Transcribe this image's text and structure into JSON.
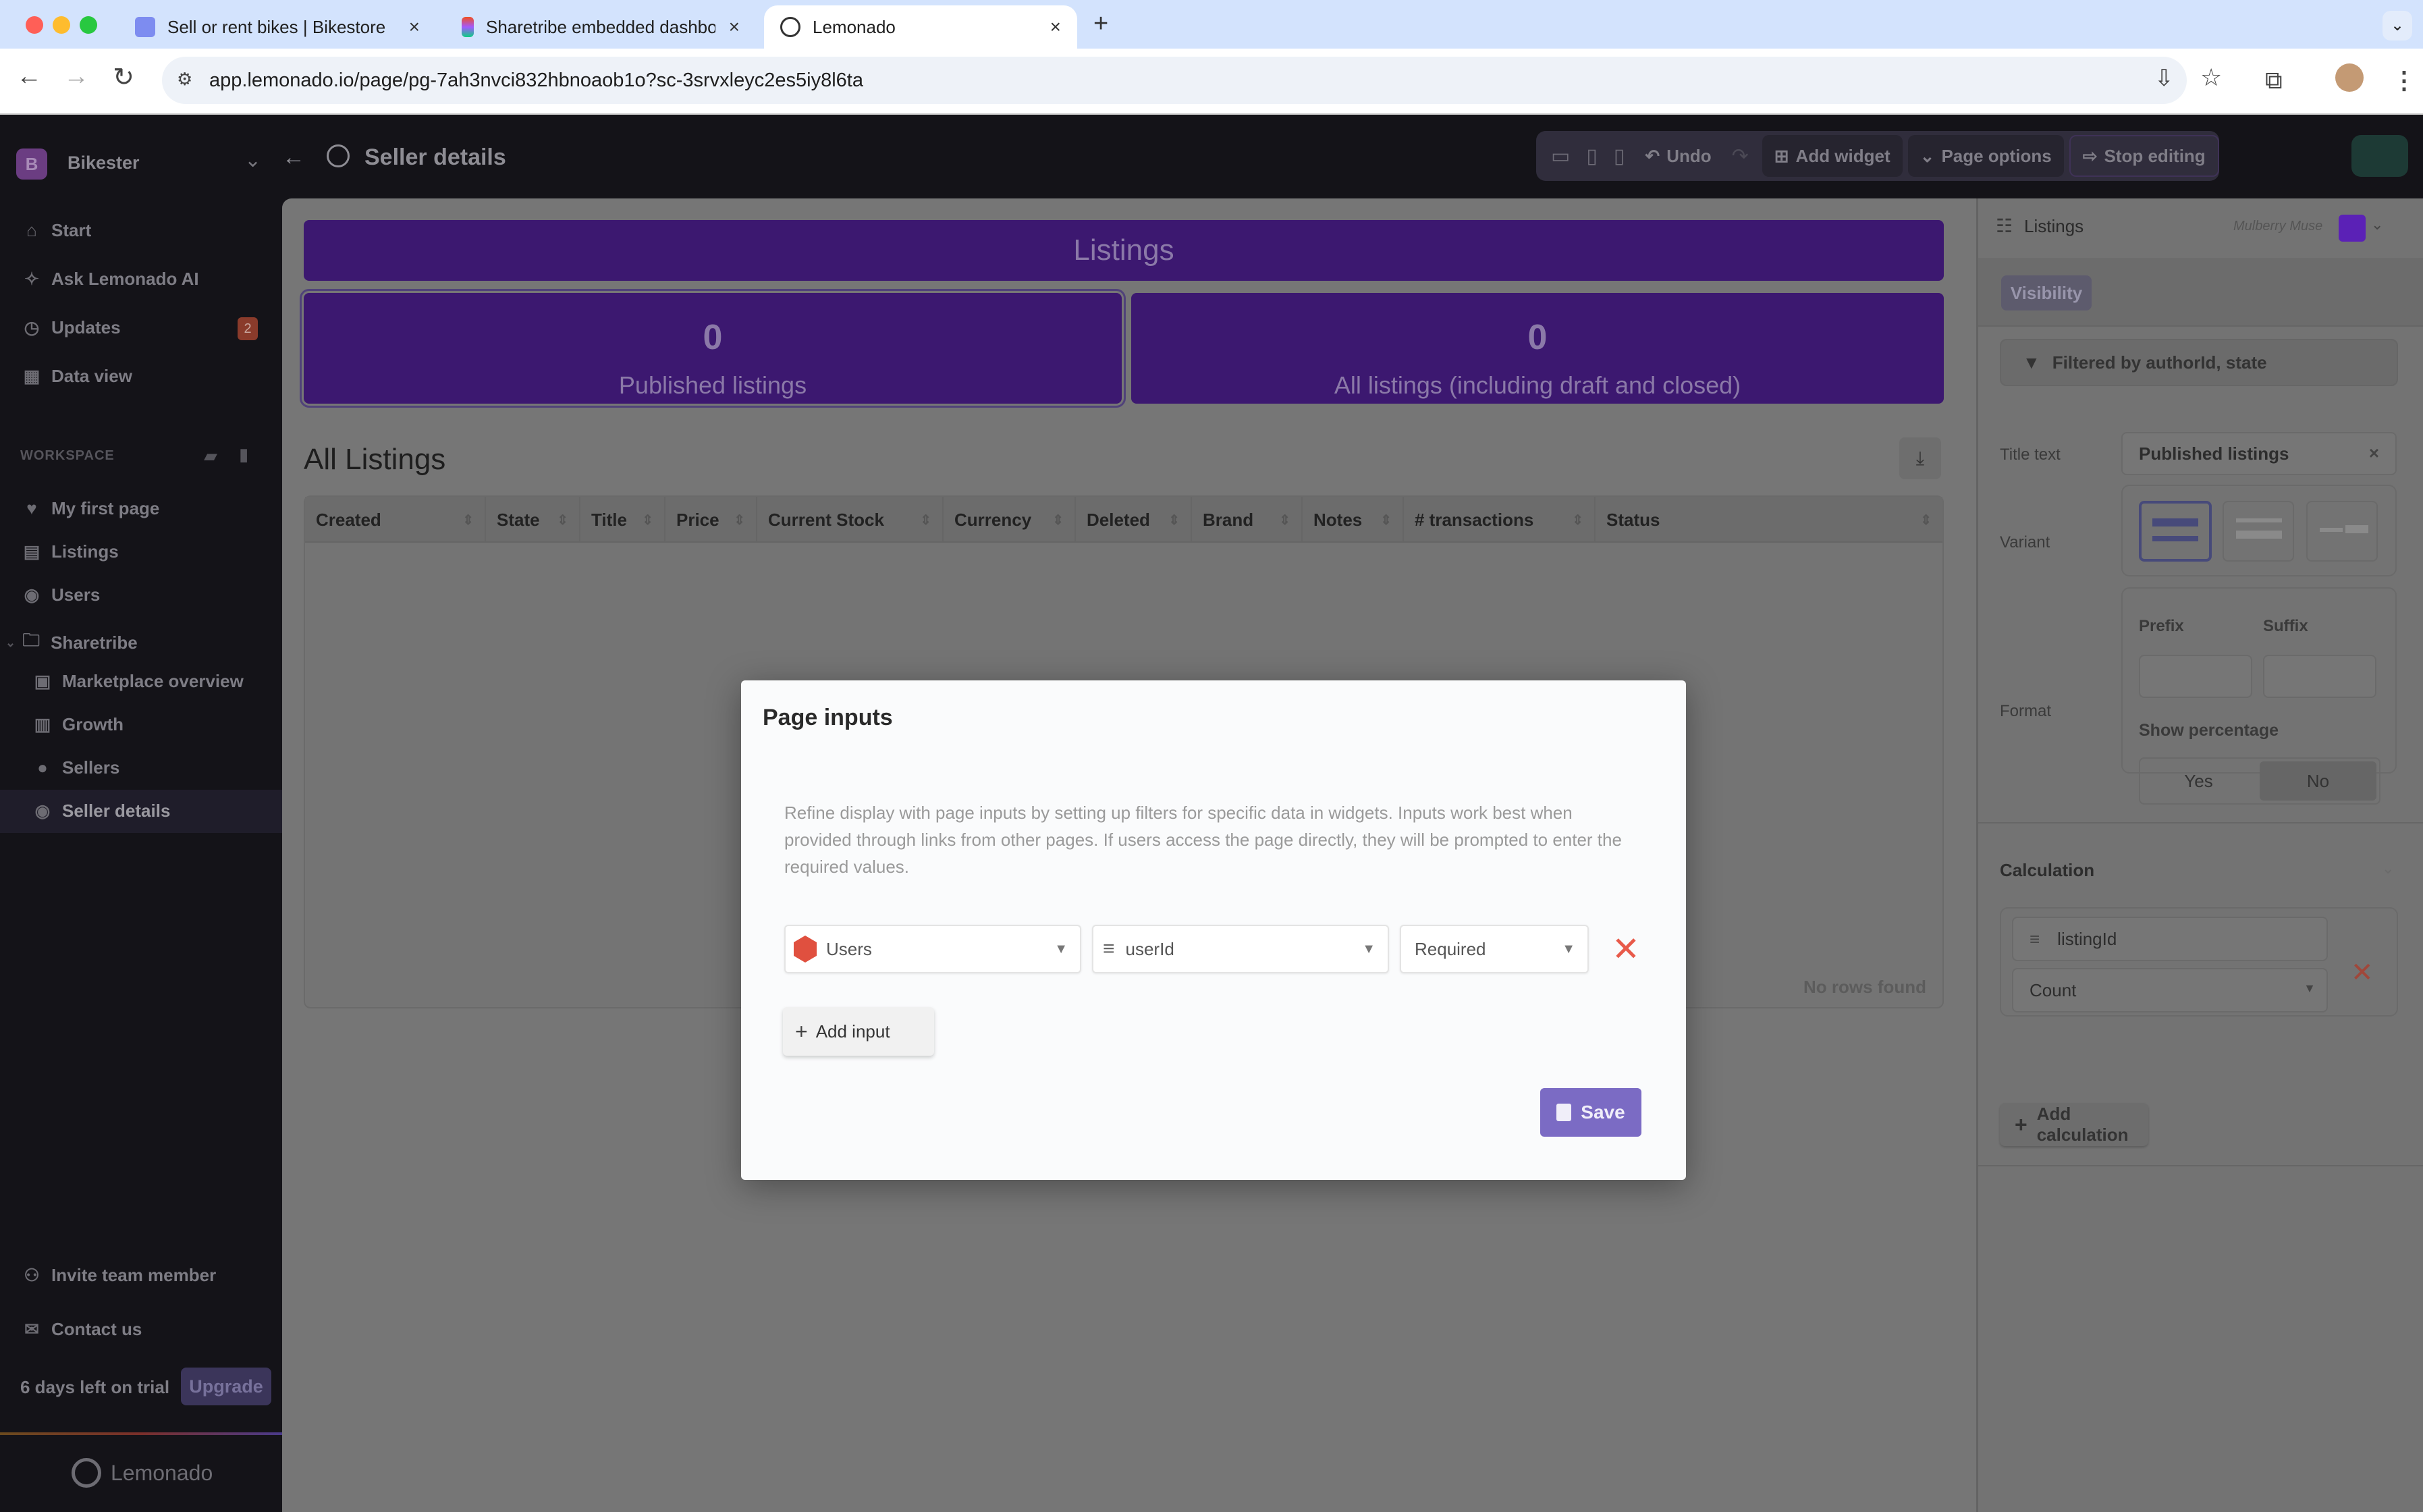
{
  "browser": {
    "tabs": [
      {
        "title": "Sell or rent bikes | Bikestore",
        "active": false
      },
      {
        "title": "Sharetribe embedded dashbo",
        "active": false
      },
      {
        "title": "Lemonado",
        "active": true
      }
    ],
    "new_tab_icon": "plus-icon",
    "url": "app.lemonado.io/page/pg-7ah3nvci832hbnoaob1o?sc-3srvxleyc2es5iy8l6ta"
  },
  "sidebar": {
    "workspace_initial": "B",
    "workspace_name": "Bikester",
    "top_items": [
      {
        "label": "Start",
        "icon": "home-icon"
      },
      {
        "label": "Ask Lemonado AI",
        "icon": "sparkles-icon"
      },
      {
        "label": "Updates",
        "icon": "clock-icon",
        "badge": "2"
      },
      {
        "label": "Data view",
        "icon": "table-icon"
      }
    ],
    "section_label": "WORKSPACE",
    "pages": [
      {
        "label": "My first page",
        "icon": "heart-icon"
      },
      {
        "label": "Listings",
        "icon": "document-icon"
      },
      {
        "label": "Users",
        "icon": "user-circle-icon"
      },
      {
        "label": "Sharetribe",
        "icon": "folder-icon"
      },
      {
        "label": "Marketplace overview",
        "icon": "image-icon"
      },
      {
        "label": "Growth",
        "icon": "bar-chart-icon"
      },
      {
        "label": "Sellers",
        "icon": "dollar-icon"
      },
      {
        "label": "Seller details",
        "icon": "user-circle-icon",
        "active": true
      }
    ],
    "invite_label": "Invite team member",
    "contact_label": "Contact us",
    "trial_text": "6 days left on trial",
    "upgrade_label": "Upgrade",
    "brand": "Lemonado"
  },
  "header": {
    "page_title": "Seller details",
    "undo_label": "Undo",
    "add_widget_label": "Add widget",
    "page_options_label": "Page options",
    "stop_editing_label": "Stop editing"
  },
  "canvas": {
    "banner_title": "Listings",
    "kpis": [
      {
        "value": "0",
        "label": "Published listings"
      },
      {
        "value": "0",
        "label": "All listings (including draft and closed)"
      }
    ],
    "table_title": "All Listings",
    "columns": [
      "Created",
      "State",
      "Title",
      "Price",
      "Current Stock",
      "Currency",
      "Deleted",
      "Brand",
      "Notes",
      "# transactions",
      "Status"
    ],
    "rows": [],
    "empty_text": "No rows found"
  },
  "right_panel": {
    "widget_name": "Listings",
    "theme_name": "Mulberry Muse",
    "theme_color": "#5b21b6",
    "visibility_tab": "Visibility",
    "filter_text": "Filtered by authorId, state",
    "title_text_label": "Title text",
    "title_text_value": "Published listings",
    "variant_label": "Variant",
    "format_label": "Format",
    "prefix_label": "Prefix",
    "prefix_value": "",
    "suffix_label": "Suffix",
    "suffix_value": "",
    "show_percentage_label": "Show percentage",
    "show_percentage_options": [
      "Yes",
      "No"
    ],
    "show_percentage_selected": "No",
    "calculation_label": "Calculation",
    "calc_field": "listingId",
    "calc_agg": "Count",
    "add_calculation_label": "Add calculation"
  },
  "modal": {
    "title": "Page inputs",
    "description": "Refine display with page inputs by setting up filters for specific data in widgets. Inputs work best when provided through links from other pages. If users access the page directly, they will be prompted to enter the required values.",
    "inputs": [
      {
        "source": "Users",
        "field": "userId",
        "requirement": "Required"
      }
    ],
    "add_input_label": "Add input",
    "save_label": "Save"
  }
}
